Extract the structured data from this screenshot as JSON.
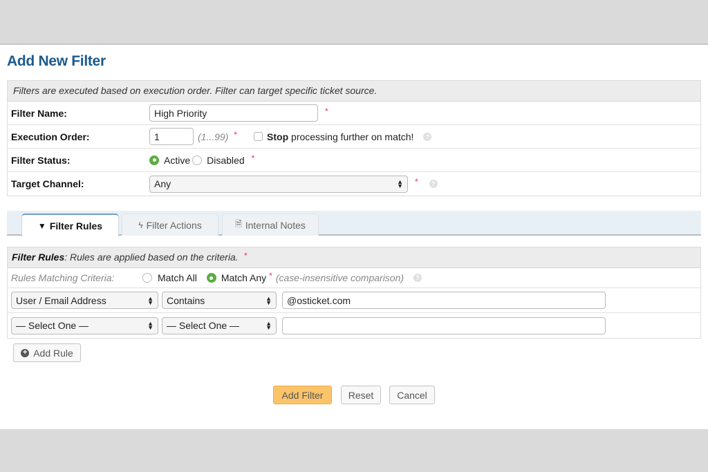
{
  "page": {
    "title": "Add New Filter"
  },
  "form": {
    "header_note": "Filters are executed based on execution order. Filter can target specific ticket source.",
    "filter_name": {
      "label": "Filter Name:",
      "value": "High Priority",
      "required": "*"
    },
    "execution_order": {
      "label": "Execution Order:",
      "value": "1",
      "range_hint": "(1...99)",
      "required": "*",
      "stop_checkbox": {
        "bold": "Stop",
        "label": " processing further on match!",
        "checked": false
      },
      "help_icon": "?"
    },
    "filter_status": {
      "label": "Filter Status:",
      "options": [
        {
          "label": "Active",
          "selected": true
        },
        {
          "label": "Disabled",
          "selected": false
        }
      ],
      "required": "*"
    },
    "target_channel": {
      "label": "Target Channel:",
      "value": "Any",
      "required": "*",
      "help_icon": "?"
    }
  },
  "tabs": [
    {
      "label": "Filter Rules",
      "icon": "filter-icon",
      "glyph": "▼",
      "active": true
    },
    {
      "label": "Filter Actions",
      "icon": "bolt-icon",
      "glyph": "ϟ",
      "active": false
    },
    {
      "label": "Internal Notes",
      "icon": "document-icon",
      "glyph": "🗎",
      "active": false
    }
  ],
  "rules": {
    "header_bold": "Filter Rules",
    "header_text": ": Rules are applied based on the criteria.",
    "required": "*",
    "criteria": {
      "label": "Rules Matching Criteria:",
      "options": [
        {
          "label": "Match All",
          "selected": false
        },
        {
          "label": "Match Any",
          "selected": true
        }
      ],
      "required": "*",
      "hint": "(case-insensitive comparison)",
      "help_icon": "?"
    },
    "rows": [
      {
        "field": "User / Email Address",
        "operator": "Contains",
        "value": "@osticket.com"
      },
      {
        "field": "— Select One —",
        "operator": "— Select One —",
        "value": ""
      }
    ],
    "add_rule_label": "Add Rule"
  },
  "buttons": {
    "submit": "Add Filter",
    "reset": "Reset",
    "cancel": "Cancel"
  },
  "colors": {
    "title": "#1c5a8c",
    "radio_selected": "#5cad43",
    "primary_button": "#fcc46a",
    "required": "#e0364f"
  }
}
